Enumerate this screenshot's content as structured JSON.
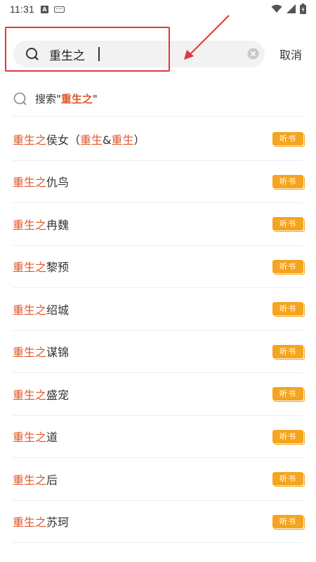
{
  "status_bar": {
    "time": "11:31",
    "notif_glyph": "A"
  },
  "search": {
    "query": "重生之",
    "cancel_label": "取消"
  },
  "suggest": {
    "prefix": "搜索\"",
    "keyword": "重生之",
    "suffix": "\""
  },
  "results": [
    {
      "parts": [
        {
          "t": "重生之",
          "hl": true
        },
        {
          "t": "侯女（",
          "hl": false
        },
        {
          "t": "重生",
          "hl": true
        },
        {
          "t": "&",
          "hl": false
        },
        {
          "t": "重生",
          "hl": true
        },
        {
          "t": "）",
          "hl": false
        }
      ],
      "tag": "听书"
    },
    {
      "parts": [
        {
          "t": "重生之",
          "hl": true
        },
        {
          "t": "仇鸟",
          "hl": false
        }
      ],
      "tag": "听书"
    },
    {
      "parts": [
        {
          "t": "重生之",
          "hl": true
        },
        {
          "t": "冉魏",
          "hl": false
        }
      ],
      "tag": "听书"
    },
    {
      "parts": [
        {
          "t": "重生之",
          "hl": true
        },
        {
          "t": "黎预",
          "hl": false
        }
      ],
      "tag": "听书"
    },
    {
      "parts": [
        {
          "t": "重生之",
          "hl": true
        },
        {
          "t": "绍城",
          "hl": false
        }
      ],
      "tag": "听书"
    },
    {
      "parts": [
        {
          "t": "重生之",
          "hl": true
        },
        {
          "t": "谋锦",
          "hl": false
        }
      ],
      "tag": "听书"
    },
    {
      "parts": [
        {
          "t": "重生之",
          "hl": true
        },
        {
          "t": "盛宠",
          "hl": false
        }
      ],
      "tag": "听书"
    },
    {
      "parts": [
        {
          "t": "重生之",
          "hl": true
        },
        {
          "t": "道",
          "hl": false
        }
      ],
      "tag": "听书"
    },
    {
      "parts": [
        {
          "t": "重生之",
          "hl": true
        },
        {
          "t": "后",
          "hl": false
        }
      ],
      "tag": "听书"
    },
    {
      "parts": [
        {
          "t": "重生之",
          "hl": true
        },
        {
          "t": "苏珂",
          "hl": false
        }
      ],
      "tag": "听书"
    }
  ],
  "colors": {
    "accent": "#e0552a",
    "tag": "#f5a420",
    "annotation": "#e2373f"
  },
  "icons": {
    "search": "search-icon",
    "clear": "clear-icon",
    "wifi": "wifi-icon",
    "signal": "signal-icon",
    "battery": "battery-icon"
  }
}
